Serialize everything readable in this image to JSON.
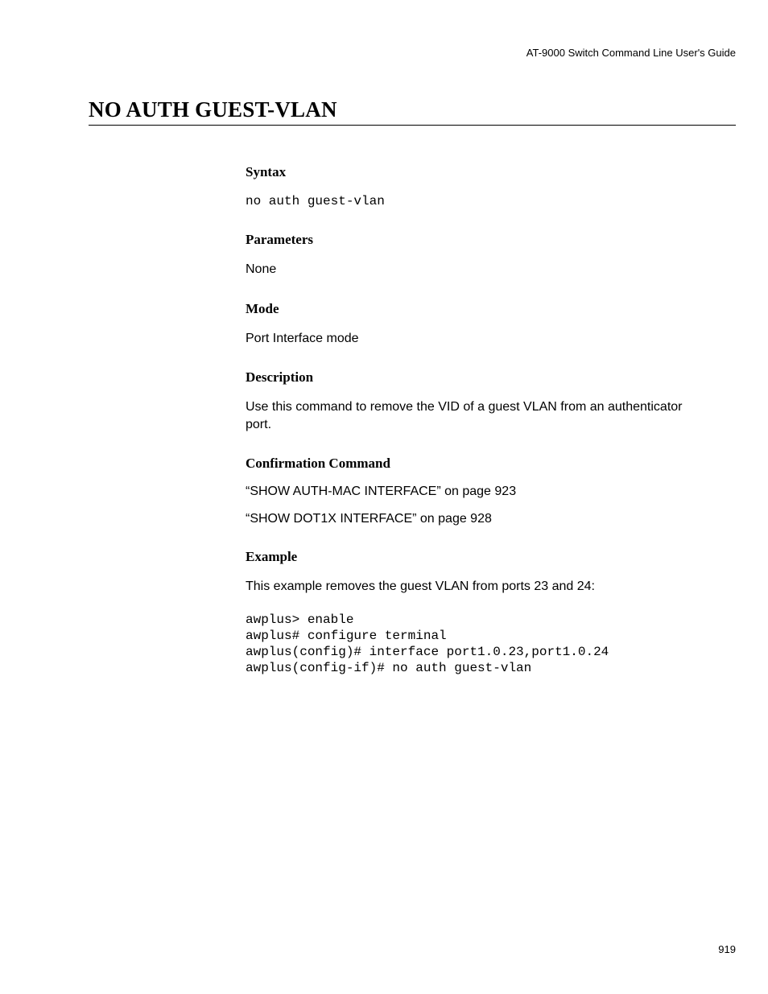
{
  "header": {
    "guide_title": "AT-9000 Switch Command Line User's Guide"
  },
  "title": "NO AUTH GUEST-VLAN",
  "sections": {
    "syntax": {
      "heading": "Syntax",
      "content": "no auth guest-vlan"
    },
    "parameters": {
      "heading": "Parameters",
      "content": "None"
    },
    "mode": {
      "heading": "Mode",
      "content": "Port Interface mode"
    },
    "description": {
      "heading": "Description",
      "content": "Use this command to remove the VID of a guest VLAN from an authenticator port."
    },
    "confirmation": {
      "heading": "Confirmation Command",
      "link1": "“SHOW AUTH-MAC INTERFACE” on page 923",
      "link2": "“SHOW DOT1X INTERFACE” on page 928"
    },
    "example": {
      "heading": "Example",
      "intro": "This example removes the guest VLAN from ports 23 and 24:",
      "code": "awplus> enable\nawplus# configure terminal\nawplus(config)# interface port1.0.23,port1.0.24\nawplus(config-if)# no auth guest-vlan"
    }
  },
  "page_number": "919"
}
